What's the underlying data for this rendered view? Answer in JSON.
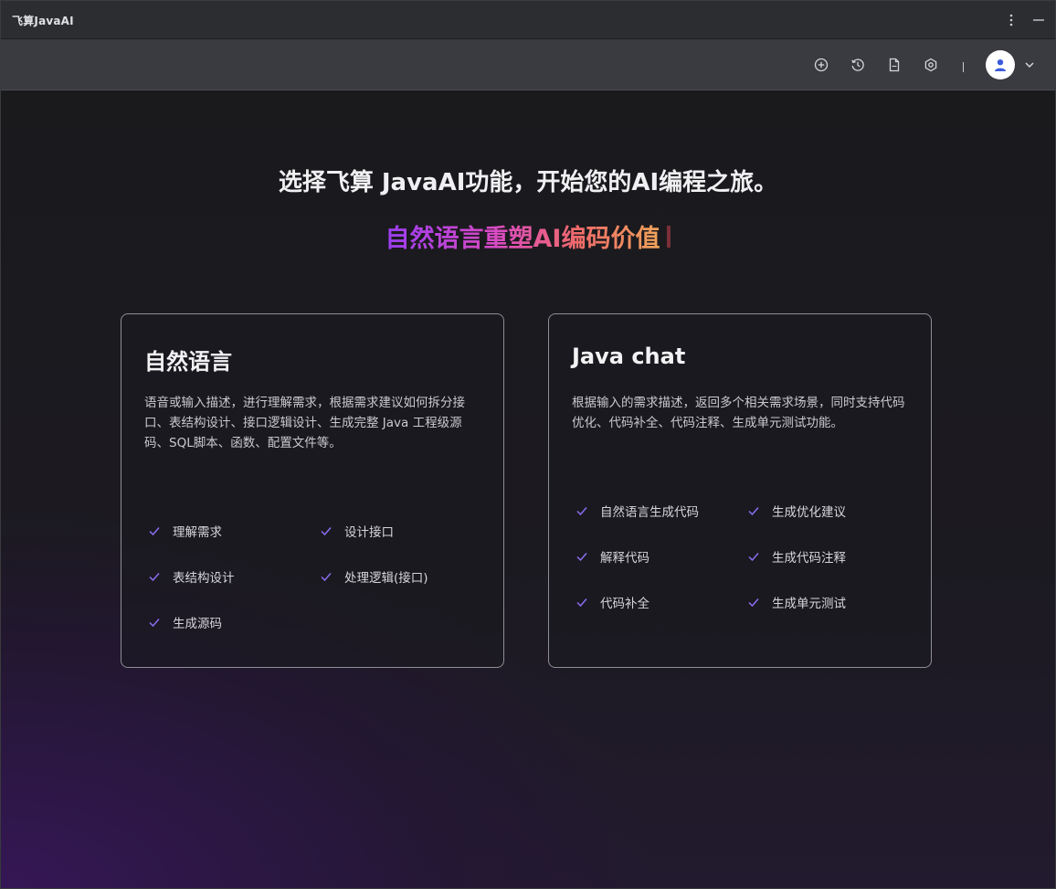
{
  "window": {
    "title": "飞算JavaAI"
  },
  "toolbar": {
    "icons": [
      "plus-circle-icon",
      "history-icon",
      "document-icon",
      "settings-icon"
    ],
    "separator": "|"
  },
  "main": {
    "headline": "选择飞算 JavaAI功能，开始您的AI编程之旅。",
    "tagline": "自然语言重塑AI编码价值",
    "accent_gradient": [
      "#9a3df0",
      "#d94ac4",
      "#f06a6a",
      "#f0a35a"
    ],
    "check_color": "#8b6cf0"
  },
  "cards": [
    {
      "title": "自然语言",
      "description": "语音或输入描述，进行理解需求，根据需求建议如何拆分接口、表结构设计、接口逻辑设计、生成完整 Java 工程级源码、SQL脚本、函数、配置文件等。",
      "features": [
        "理解需求",
        "设计接口",
        "表结构设计",
        "处理逻辑(接口)",
        "生成源码"
      ]
    },
    {
      "title": "Java chat",
      "description": "根据输入的需求描述，返回多个相关需求场景，同时支持代码优化、代码补全、代码注释、生成单元测试功能。",
      "features": [
        "自然语言生成代码",
        "生成优化建议",
        "解释代码",
        "生成代码注释",
        "代码补全",
        "生成单元测试"
      ]
    }
  ]
}
